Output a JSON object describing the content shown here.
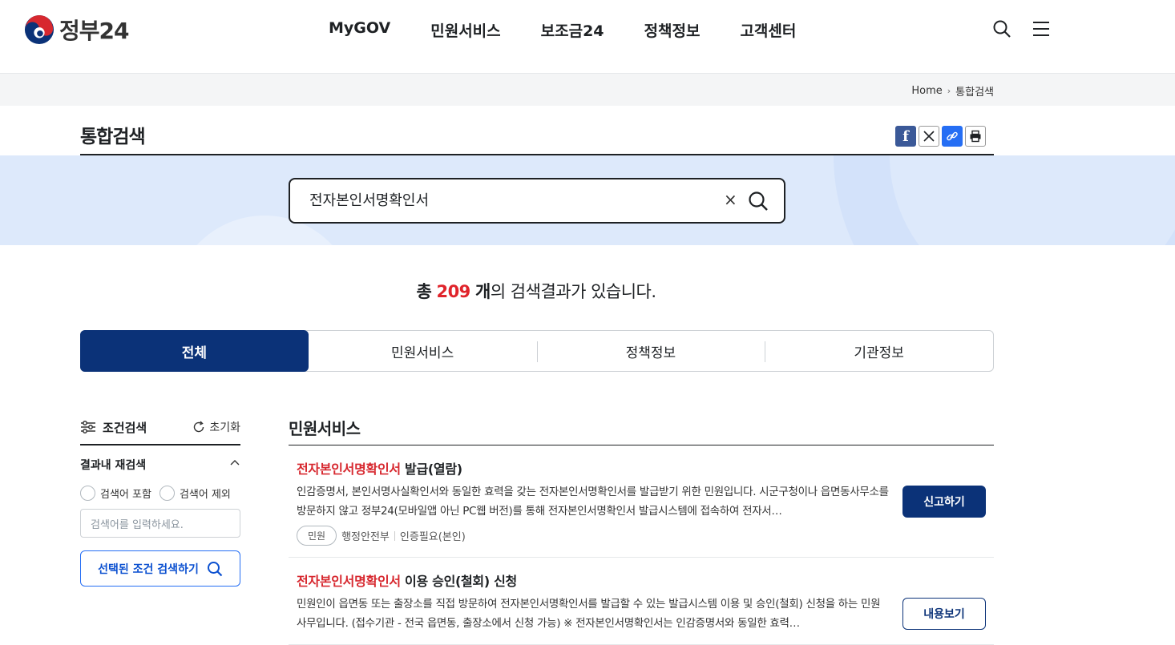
{
  "header": {
    "logo_text": "정부24",
    "nav": [
      "MyGOV",
      "민원서비스",
      "보조금24",
      "정책정보",
      "고객센터"
    ],
    "icons": [
      "search-icon",
      "menu-icon"
    ]
  },
  "breadcrumb": {
    "home": "Home",
    "current": "통합검색"
  },
  "page": {
    "title": "통합검색"
  },
  "share": [
    "facebook-icon",
    "x-icon",
    "link-icon",
    "print-icon"
  ],
  "search": {
    "query": "전자본인서명확인서",
    "clear_label": "×"
  },
  "result": {
    "prefix": "총",
    "count": "209",
    "unit": "개",
    "suffix": "의 검색결과가 있습니다."
  },
  "tabs": [
    "전체",
    "민원서비스",
    "정책정보",
    "기관정보"
  ],
  "sidebar": {
    "title": "조건검색",
    "reset": "초기화",
    "sub_title": "결과내 재검색",
    "radio_include": "검색어 포함",
    "radio_exclude": "검색어 제외",
    "input_placeholder": "검색어를 입력하세요.",
    "submit": "선택된 조건 검색하기"
  },
  "main": {
    "section_title": "민원서비스",
    "items": [
      {
        "title_hl": "전자본인서명확인서",
        "title_rest": " 발급(열람)",
        "desc": "인감증명서, 본인서명사실확인서와 동일한 효력을 갖는 전자본인서명확인서를 발급받기 위한 민원입니다. 시군구청이나 읍면동사무소를 방문하지 않고 정부24(모바일앱 아닌 PC웹 버전)를 통해 전자본인서명확인서 발급시스템에 접속하여 전자서…",
        "tag": "민원",
        "org": "행정안전부",
        "auth": "인증필요(본인)",
        "button": "신고하기"
      },
      {
        "title_hl": "전자본인서명확인서",
        "title_rest": " 이용 승인(철회) 신청",
        "desc": "민원인이 읍면동 또는 출장소를 직접 방문하여 전자본인서명확인서를 발급할 수 있는 발급시스템 이용 및 승인(철회) 신청을 하는 민원사무입니다. (접수기관 - 전국 읍면동, 출장소에서 신청 가능) ※ 전자본인서명확인서는 인감증명서와 동일한 효력…",
        "button": "내용보기"
      }
    ]
  }
}
